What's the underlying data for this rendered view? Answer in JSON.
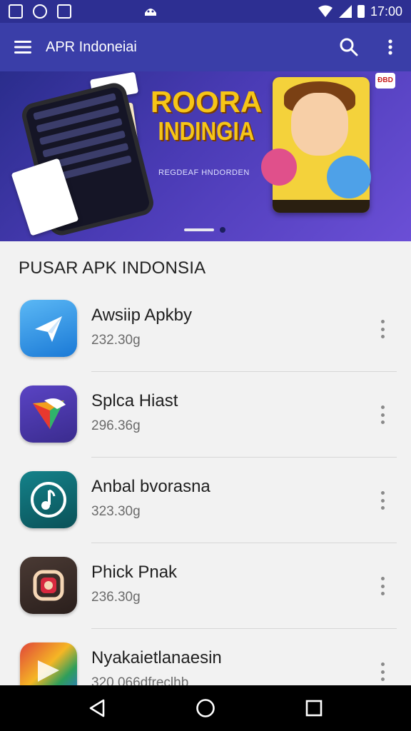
{
  "status_bar": {
    "time": "17:00",
    "icons": [
      "gallery-icon",
      "whatsapp-icon",
      "app-store-icon",
      "android-icon",
      "wifi-icon",
      "signal-icon",
      "battery-icon"
    ]
  },
  "app_bar": {
    "title": "APR Indoneiai",
    "icons": [
      "menu-icon",
      "search-icon",
      "more-vert-icon"
    ],
    "background_color": "#3a3ea8"
  },
  "banner": {
    "title_line1": "ROORA",
    "title_line2": "INDINGIA",
    "subtitle": "REGDEAF HNDORDEN",
    "badge": "ÐBD",
    "carousel_position": 1,
    "carousel_count": 2
  },
  "section": {
    "title": "PUSAR APK INDONSIA"
  },
  "apps": [
    {
      "name": "Awsiip Apkby",
      "size": "232.30g",
      "icon": "paper-plane-icon",
      "icon_color": "#2e8fe6"
    },
    {
      "name": "Splca Hiast",
      "size": "296.36g",
      "icon": "colorful-arrow-icon",
      "icon_color": "#4b36a8"
    },
    {
      "name": "Anbal bvorasna",
      "size": "323.30g",
      "icon": "music-note-icon",
      "icon_color": "#0f6b72"
    },
    {
      "name": "Phick Pnak",
      "size": "236.30g",
      "icon": "camera-icon",
      "icon_color": "#3a2a26"
    },
    {
      "name": "Nyakaietlanaesin",
      "size": "320.066dfreclhb",
      "icon": "multicolor-arrow-icon",
      "icon_color": "#e0443a"
    }
  ],
  "nav_bar": {
    "icons": [
      "back-icon",
      "home-icon",
      "recents-icon"
    ]
  }
}
